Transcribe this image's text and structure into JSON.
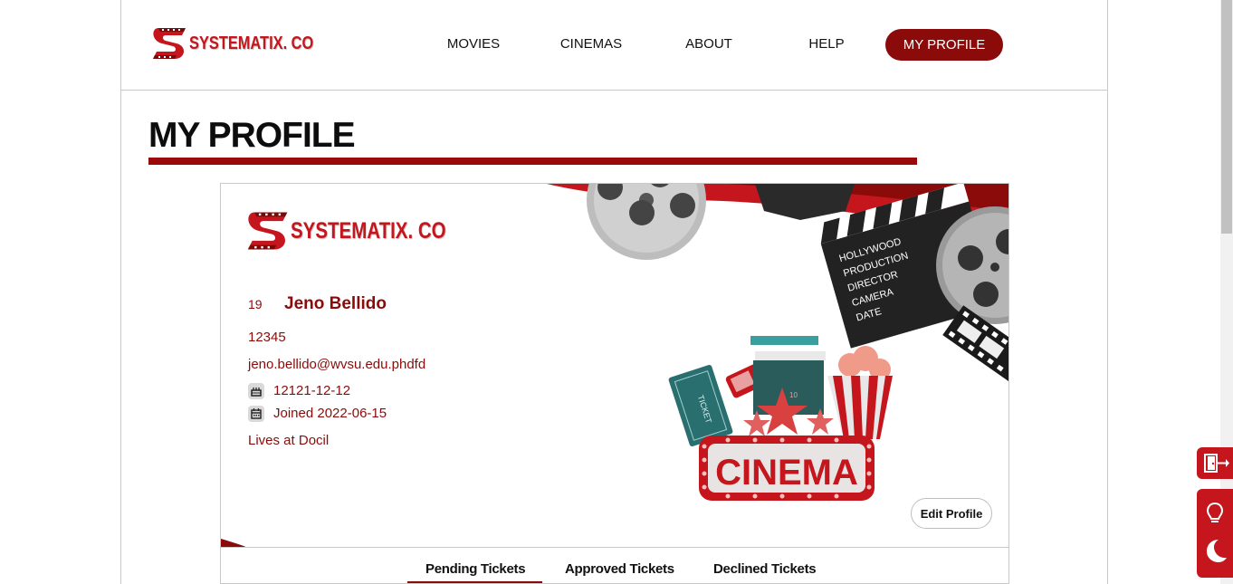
{
  "brand": {
    "name": "SYSTEMATIX. CO"
  },
  "nav": {
    "items": [
      "MOVIES",
      "CINEMAS",
      "ABOUT",
      "HELP"
    ],
    "active": "MY PROFILE"
  },
  "page": {
    "title": "MY PROFILE"
  },
  "profile": {
    "id": "19",
    "name": "Jeno Bellido",
    "number": "12345",
    "email": "jeno.bellido@wvsu.edu.phdfd",
    "birthday": "12121-12-12",
    "joined": "Joined 2022-06-15",
    "location": "Lives at Docil",
    "edit_label": "Edit Profile"
  },
  "art": {
    "cinema_sign": "CINEMA",
    "ticket_text": "TICKET",
    "clapper_lines": [
      "HOLLYWOOD",
      "PRODUCTION",
      "DIRECTOR",
      "CAMERA",
      "DATE"
    ]
  },
  "tabs": [
    "Pending Tickets",
    "Approved Tickets",
    "Declined Tickets"
  ],
  "colors": {
    "brand": "#8b0b0b",
    "accent": "#c4161c"
  },
  "side_buttons": [
    "logout-icon",
    "lightbulb-icon",
    "moon-icon"
  ]
}
